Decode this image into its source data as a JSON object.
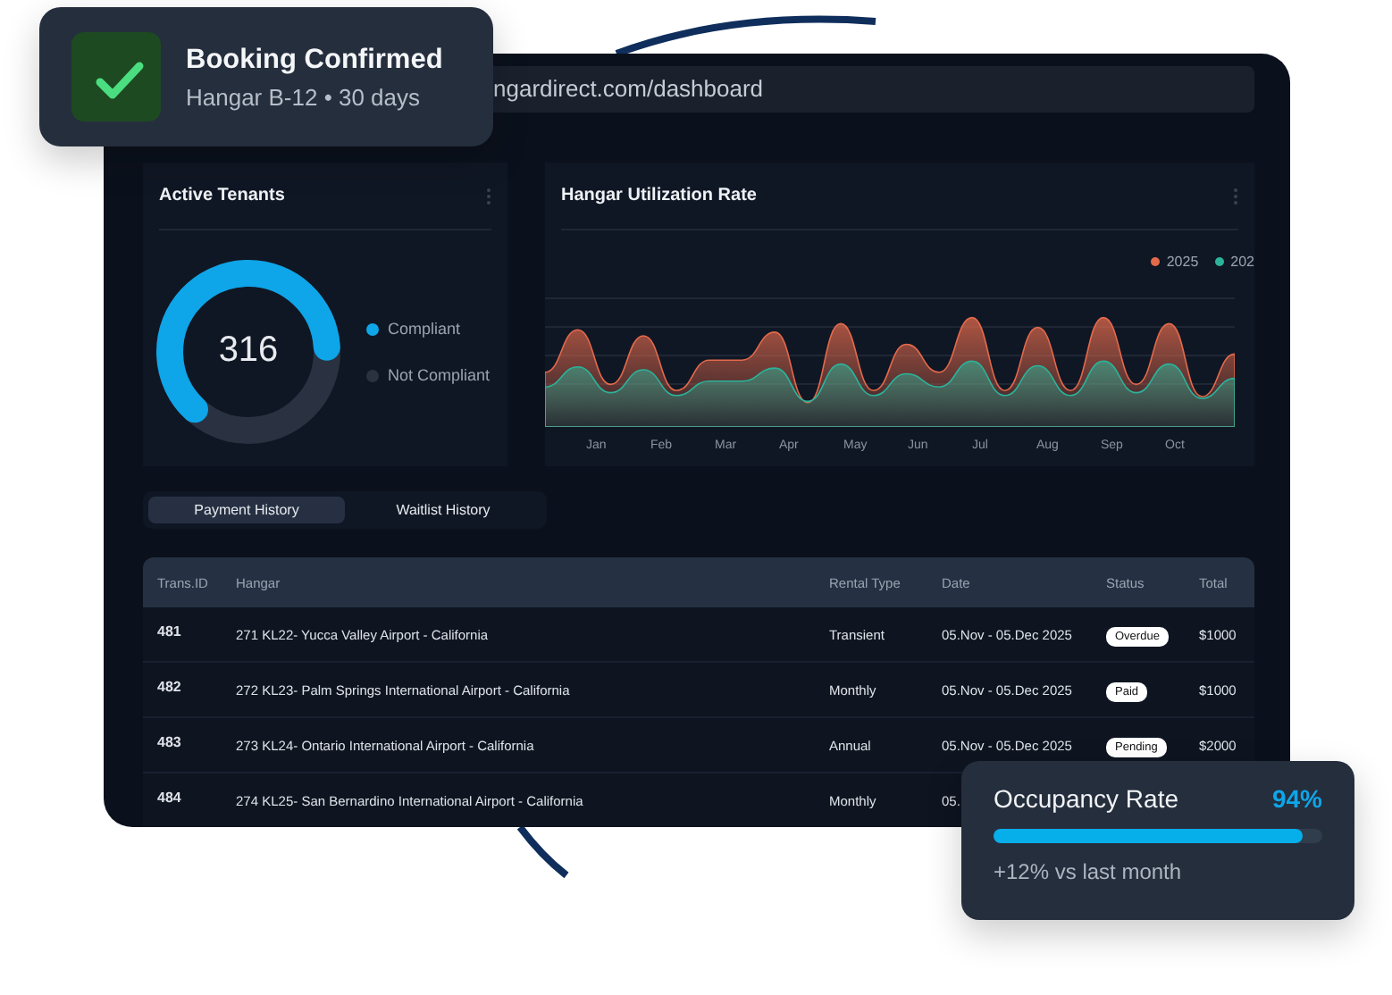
{
  "toast": {
    "title": "Booking Confirmed",
    "subtitle": "Hangar B-12 • 30 days"
  },
  "address_bar": {
    "url": "ngardirect.com/dashboard"
  },
  "tenants_card": {
    "title": "Active Tenants",
    "total": "316",
    "legend": [
      {
        "label": "Compliant",
        "color": "#0ea5e9"
      },
      {
        "label": "Not Compliant",
        "color": "#2a3241"
      }
    ]
  },
  "utilization_card": {
    "title": "Hangar Utilization Rate",
    "legend": [
      {
        "label": "2025",
        "color": "#e46a4c"
      },
      {
        "label": "202",
        "color": "#2bb39a"
      }
    ],
    "months": [
      "Jan",
      "Feb",
      "Mar",
      "Apr",
      "May",
      "Jun",
      "Jul",
      "Aug",
      "Sep",
      "Oct"
    ]
  },
  "tabs": [
    {
      "label": "Payment History",
      "selected": true
    },
    {
      "label": "Waitlist History",
      "selected": false
    }
  ],
  "table": {
    "columns": [
      "Trans.ID",
      "Hangar",
      "Rental Type",
      "Date",
      "Status",
      "Total"
    ],
    "rows": [
      {
        "id": "481",
        "hangar": "271 KL22- Yucca Valley Airport - California",
        "rental_type": "Transient",
        "date": "05.Nov - 05.Dec 2025",
        "status": "Overdue",
        "total": "$1000"
      },
      {
        "id": "482",
        "hangar": "272 KL23- Palm Springs International Airport - California",
        "rental_type": "Monthly",
        "date": "05.Nov - 05.Dec 2025",
        "status": "Paid",
        "total": "$1000"
      },
      {
        "id": "483",
        "hangar": "273 KL24- Ontario International Airport - California",
        "rental_type": "Annual",
        "date": "05.Nov - 05.Dec 2025",
        "status": "Pending",
        "total": "$2000"
      },
      {
        "id": "484",
        "hangar": "274 KL25- San Bernardino International Airport - California",
        "rental_type": "Monthly",
        "date": "05."
      }
    ]
  },
  "occupancy": {
    "title": "Occupancy Rate",
    "value": "94%",
    "level": 0.94,
    "change": "+12% vs last month"
  }
}
